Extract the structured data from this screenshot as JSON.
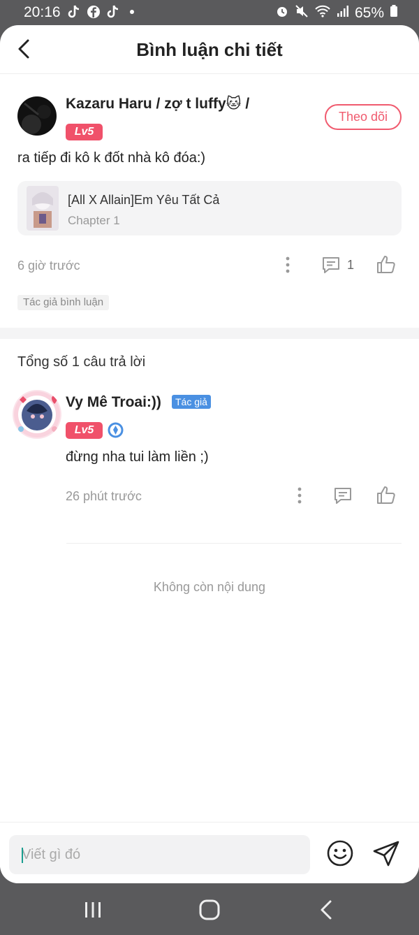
{
  "status_bar": {
    "time": "20:16",
    "battery": "65%",
    "icons": [
      "tiktok-icon",
      "facebook-icon",
      "tiktok-icon",
      "alarm-icon",
      "mute-icon",
      "wifi-icon",
      "signal-icon",
      "battery-icon"
    ]
  },
  "header": {
    "title": "Bình luận chi tiết",
    "back_icon": "chevron-left-icon"
  },
  "main_comment": {
    "username": "Kazaru Haru / zợ t luffy🐱 /",
    "level": "Lv5",
    "follow_label": "Theo dõi",
    "text": "ra tiếp đi kô k đốt nhà kô đóa:)",
    "story": {
      "title": "[All X Allain]Em Yêu Tất Cả",
      "chapter": "Chapter 1"
    },
    "time": "6 giờ trước",
    "reply_count": "1",
    "author_tag": "Tác giả bình luận"
  },
  "replies_section": {
    "total_label": "Tổng số 1 câu trả lời"
  },
  "reply": {
    "username": "Vy Mê Troai:))",
    "author_label": "Tác giả",
    "level": "Lv5",
    "text": "đừng nha tui làm liền ;)",
    "time": "26 phút trước"
  },
  "end_label": "Không còn nội dung",
  "input": {
    "placeholder": "Viết gì đó"
  },
  "colors": {
    "accent": "#f0516a",
    "author_blue": "#4a90e2",
    "muted_text": "#999999",
    "system_bar": "#5a5a5c"
  }
}
